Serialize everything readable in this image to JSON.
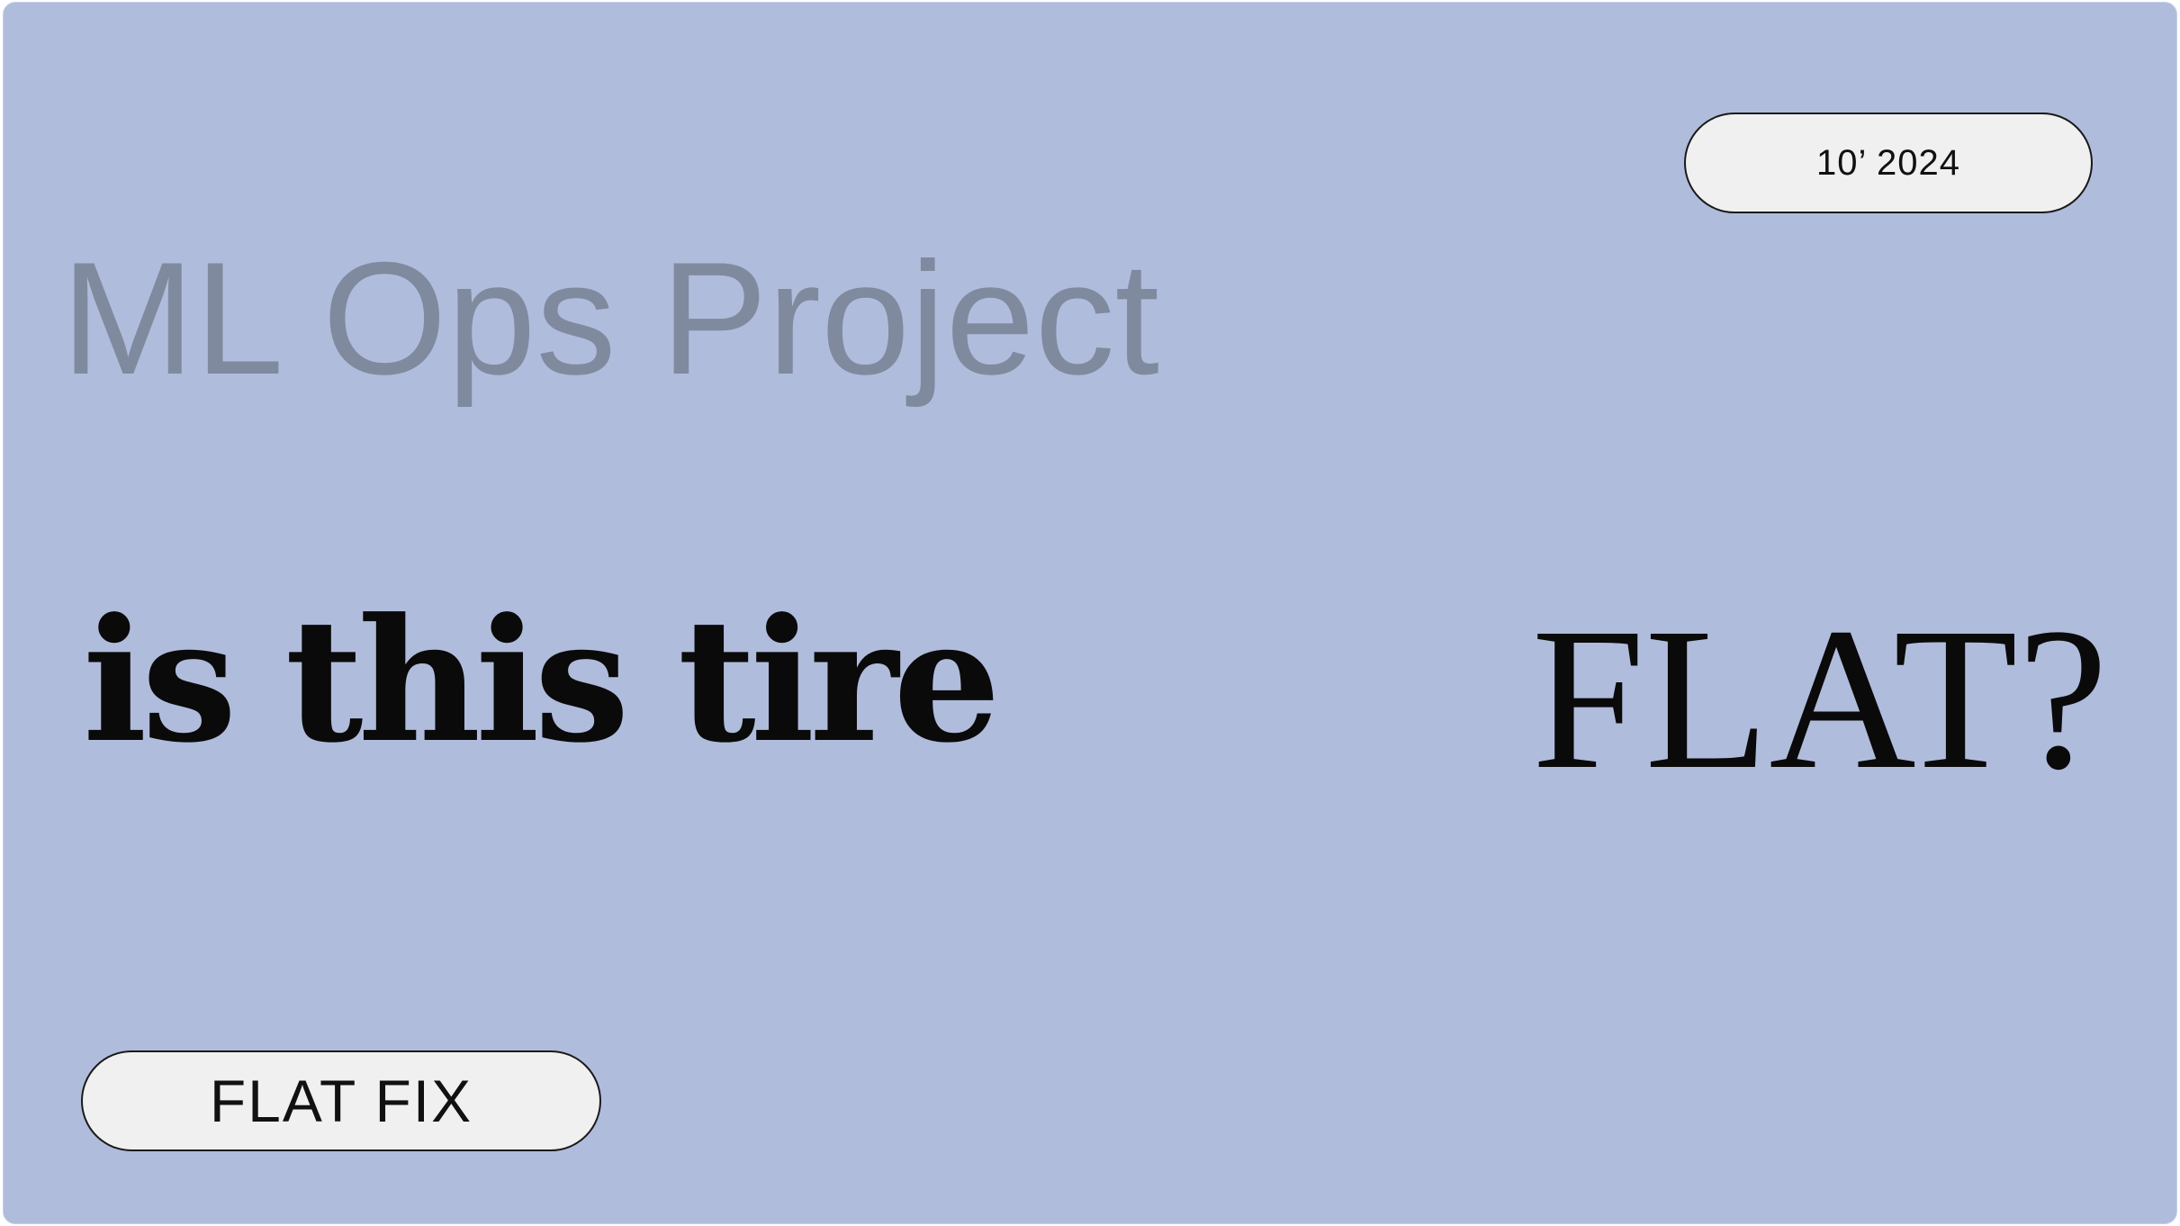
{
  "slide": {
    "background_color": "#b0bcdc",
    "date": "10’ 2024",
    "title": "ML Ops Project",
    "question": "is this tire",
    "emphasis": "FLAT?",
    "tag": "FLAT FIX"
  }
}
